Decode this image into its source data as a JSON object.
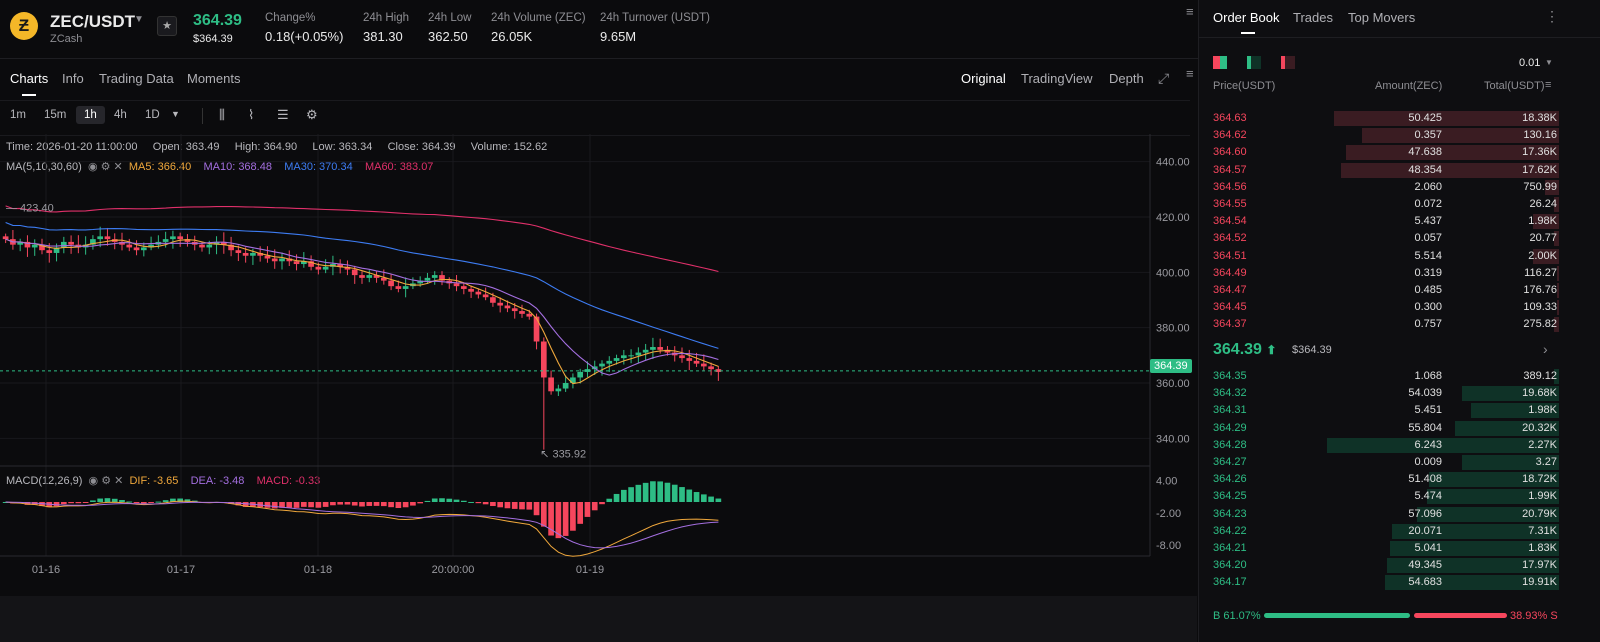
{
  "pair": {
    "symbol": "ZEC/USDT",
    "name": "ZCash",
    "price": "364.39",
    "price_usd": "$364.39"
  },
  "stats": [
    {
      "label": "Change%",
      "value": "0.18(+0.05%)",
      "color": "#2ebd85"
    },
    {
      "label": "24h High",
      "value": "381.30"
    },
    {
      "label": "24h Low",
      "value": "362.50"
    },
    {
      "label": "24h Volume (ZEC)",
      "value": "26.05K"
    },
    {
      "label": "24h Turnover (USDT)",
      "value": "9.65M"
    }
  ],
  "tabs": [
    "Charts",
    "Info",
    "Trading Data",
    "Moments"
  ],
  "views": [
    "Original",
    "TradingView",
    "Depth"
  ],
  "timeframes": [
    "1m",
    "15m",
    "1h",
    "4h",
    "1D"
  ],
  "ohlc": {
    "time": "Time: 2026-01-20 11:00:00",
    "open": "Open: 363.49",
    "high": "High: 364.90",
    "low": "Low: 363.34",
    "close": "Close: 364.39",
    "volume": "Volume: 152.62"
  },
  "ma": {
    "label": "MA(5,10,30,60)",
    "ma5": "MA5: 366.40",
    "ma10": "MA10: 368.48",
    "ma30": "MA30: 370.34",
    "ma60": "MA60: 383.07"
  },
  "macd": {
    "label": "MACD(12,26,9)",
    "dif": "DIF: -3.65",
    "dea": "DEA: -3.48",
    "macd": "MACD: -0.33"
  },
  "colors": {
    "up": "#2ebd85",
    "down": "#f6465d",
    "ma5": "#f0a83c",
    "ma10": "#a46fe0",
    "ma30": "#3d7cf2",
    "ma60": "#e0306a"
  },
  "chart_data": {
    "type": "candlestick",
    "y_ticks": [
      "440.00",
      "420.00",
      "400.00",
      "380.00",
      "360.00"
    ],
    "y_ticks_extra": [
      "340.00"
    ],
    "ylim": [
      330,
      450
    ],
    "x_ticks": [
      "01-16",
      "01-17",
      "01-18",
      "20:00:00",
      "01-19"
    ],
    "high_marker": "423.40",
    "low_marker": "335.92",
    "last_price": "364.39",
    "macd_ticks": [
      "4.00",
      "-2.00",
      "-8.00"
    ],
    "close_series": [
      412,
      410,
      411,
      409,
      410,
      408,
      407,
      409,
      411,
      410,
      409,
      410,
      412,
      413,
      412,
      411,
      410,
      409,
      408,
      409,
      410,
      411,
      412,
      413,
      412,
      411,
      410,
      409,
      410,
      411,
      410,
      408,
      407,
      406,
      407,
      406,
      405,
      404,
      405,
      404,
      403,
      404,
      402,
      401,
      402,
      403,
      402,
      401,
      399,
      398,
      399,
      398,
      397,
      395,
      394,
      395,
      396,
      397,
      398,
      399,
      397,
      396,
      395,
      394,
      393,
      392,
      391,
      389,
      388,
      387,
      386,
      385,
      384,
      375,
      362,
      357,
      358,
      360,
      362,
      364,
      365,
      366,
      367,
      368,
      369,
      370,
      370,
      371,
      372,
      373,
      372,
      371,
      370,
      369,
      368,
      367,
      366,
      365,
      364
    ]
  },
  "orderbook": {
    "tabs": [
      "Order Book",
      "Trades",
      "Top Movers"
    ],
    "tick": "0.01",
    "headers": [
      "Price(USDT)",
      "Amount(ZEC)",
      "Total(USDT)"
    ],
    "asks": [
      [
        "364.63",
        "50.425",
        "18.38K",
        0.97
      ],
      [
        "364.62",
        "0.357",
        "130.16",
        0.85
      ],
      [
        "364.60",
        "47.638",
        "17.36K",
        0.92
      ],
      [
        "364.57",
        "48.354",
        "17.62K",
        0.94
      ],
      [
        "364.56",
        "2.060",
        "750.99",
        0.06
      ],
      [
        "364.55",
        "0.072",
        "26.24",
        0.02
      ],
      [
        "364.54",
        "5.437",
        "1.98K",
        0.11
      ],
      [
        "364.52",
        "0.057",
        "20.77",
        0.02
      ],
      [
        "364.51",
        "5.514",
        "2.00K",
        0.11
      ],
      [
        "364.49",
        "0.319",
        "116.27",
        0.01
      ],
      [
        "364.47",
        "0.485",
        "176.76",
        0.01
      ],
      [
        "364.45",
        "0.300",
        "109.33",
        0.01
      ],
      [
        "364.37",
        "0.757",
        "275.82",
        0.02
      ]
    ],
    "mid_price": "364.39",
    "mid_usd": "$364.39",
    "bids": [
      [
        "364.35",
        "1.068",
        "389.12",
        0.02
      ],
      [
        "364.32",
        "54.039",
        "19.68K",
        0.42
      ],
      [
        "364.31",
        "5.451",
        "1.98K",
        0.38
      ],
      [
        "364.29",
        "55.804",
        "20.32K",
        0.45
      ],
      [
        "364.28",
        "6.243",
        "2.27K",
        1.0
      ],
      [
        "364.27",
        "0.009",
        "3.27",
        0.42
      ],
      [
        "364.26",
        "51.408",
        "18.72K",
        0.56
      ],
      [
        "364.25",
        "5.474",
        "1.99K",
        0.57
      ],
      [
        "364.23",
        "57.096",
        "20.79K",
        0.61
      ],
      [
        "364.22",
        "20.071",
        "7.31K",
        0.72
      ],
      [
        "364.21",
        "5.041",
        "1.83K",
        0.73
      ],
      [
        "364.20",
        "49.345",
        "17.97K",
        0.74
      ],
      [
        "364.17",
        "54.683",
        "19.91K",
        0.75
      ]
    ],
    "buy_ratio": "B 61.07%",
    "sell_ratio": "38.93% S",
    "buy_frac": 0.6107
  }
}
